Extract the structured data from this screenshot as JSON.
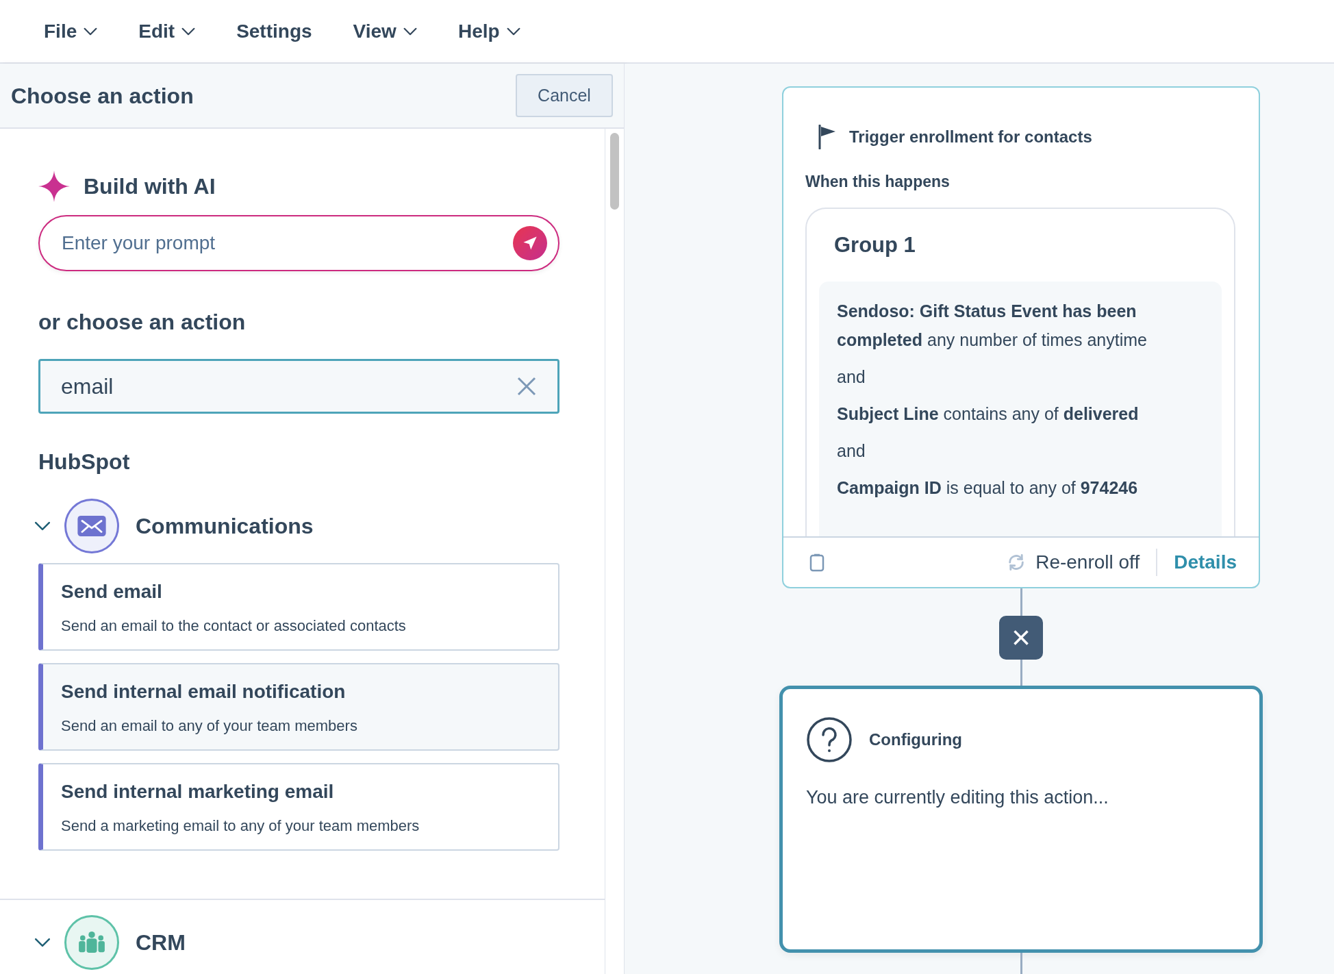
{
  "menu": [
    {
      "label": "File",
      "dropdown": true
    },
    {
      "label": "Edit",
      "dropdown": true
    },
    {
      "label": "Settings",
      "dropdown": false
    },
    {
      "label": "View",
      "dropdown": true
    },
    {
      "label": "Help",
      "dropdown": true
    }
  ],
  "panel": {
    "title": "Choose an action",
    "cancel": "Cancel",
    "ai": {
      "heading": "Build with AI",
      "placeholder": "Enter your prompt"
    },
    "search": {
      "heading": "or choose an action",
      "value": "email"
    },
    "source": "HubSpot",
    "categories": [
      {
        "name": "Communications",
        "kind": "communications",
        "expanded": true,
        "actions": [
          {
            "title": "Send email",
            "description": "Send an email to the contact or associated contacts",
            "highlighted": false
          },
          {
            "title": "Send internal email notification",
            "description": "Send an email to any of your team members",
            "highlighted": true
          },
          {
            "title": "Send internal marketing email",
            "description": "Send a marketing email to any of your team members",
            "highlighted": false
          }
        ]
      },
      {
        "name": "CRM",
        "kind": "crm",
        "expanded": true
      }
    ]
  },
  "canvas": {
    "trigger": {
      "title": "Trigger enrollment for contacts",
      "subtitle": "When this happens",
      "group": "Group 1",
      "conditions": [
        {
          "kind": "condition",
          "text": "**Sendoso: Gift Status Event has been completed** any number of times anytime"
        },
        {
          "kind": "operator",
          "text": "and"
        },
        {
          "kind": "condition",
          "text": "**Subject Line** contains any of **delivered**"
        },
        {
          "kind": "operator",
          "text": "and"
        },
        {
          "kind": "condition",
          "text": "**Campaign ID** is equal to any of **974246**"
        }
      ],
      "reenroll": "Re-enroll off",
      "details": "Details"
    },
    "remove_button": "×",
    "action": {
      "title": "Configuring",
      "text": "You are currently editing this action..."
    }
  }
}
